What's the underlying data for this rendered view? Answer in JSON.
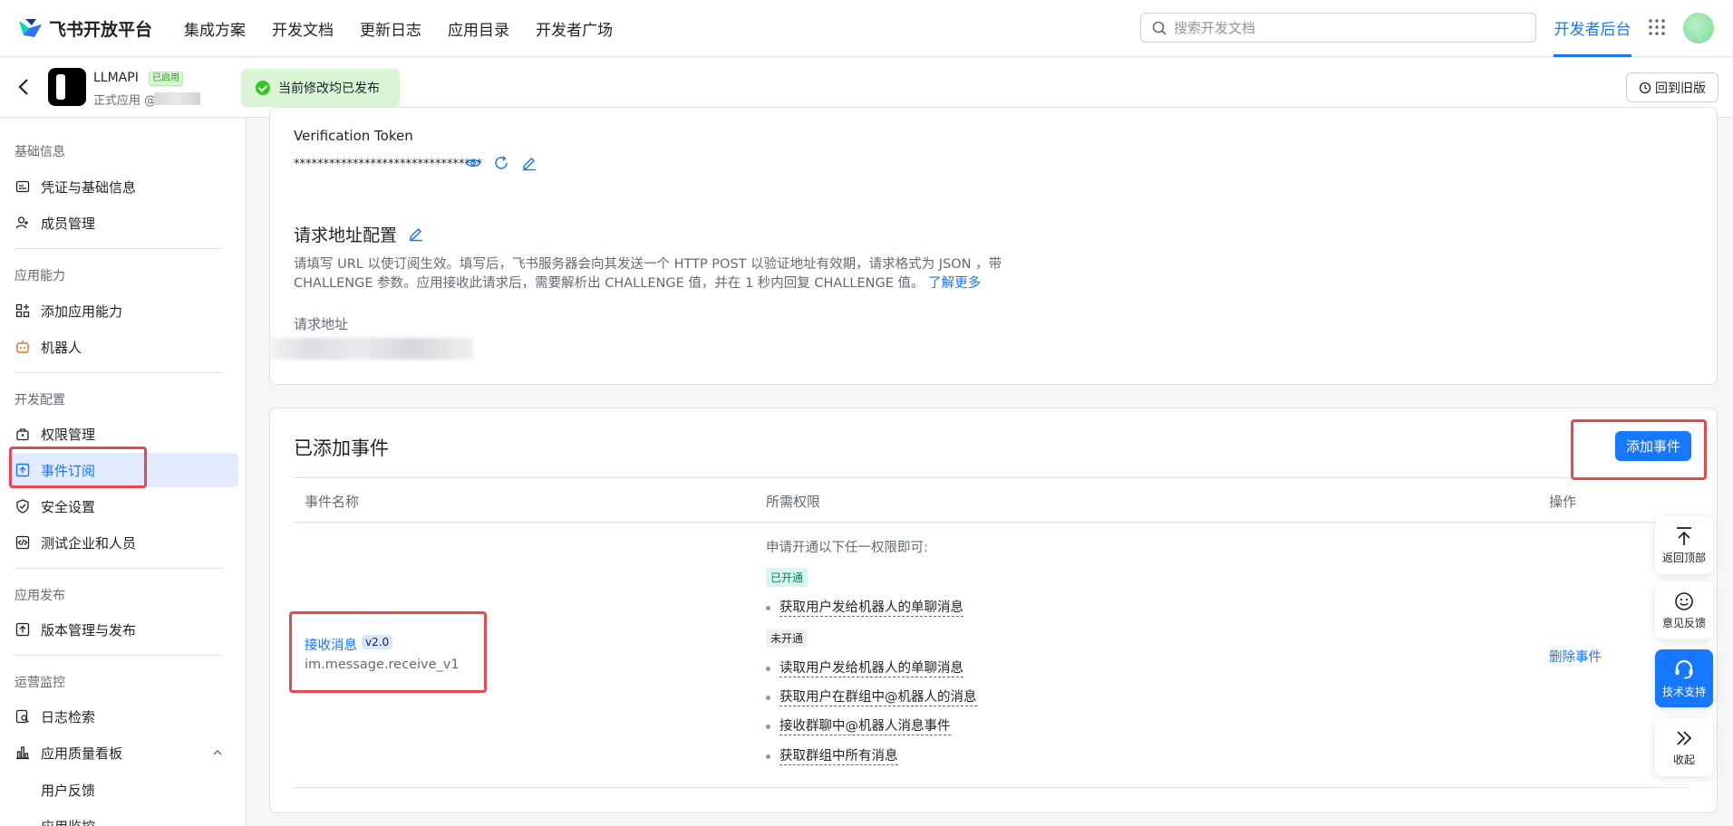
{
  "topnav": {
    "brand": "飞书开放平台",
    "links": [
      "集成方案",
      "开发文档",
      "更新日志",
      "应用目录",
      "开发者广场"
    ],
    "search_placeholder": "搜索开发文档",
    "dev_console": "开发者后台",
    "accent": "#1677ff"
  },
  "appbar": {
    "app_name": "LLMAPI",
    "app_status": "已启用",
    "app_sub": "正式应用 @",
    "publish_status": "当前修改均已发布",
    "revert_label": "回到旧版"
  },
  "sidebar": {
    "groups": {
      "basic": "基础信息",
      "capability": "应用能力",
      "dev": "开发配置",
      "release": "应用发布",
      "ops": "运营监控"
    },
    "items": {
      "credentials": "凭证与基础信息",
      "members": "成员管理",
      "add_capability": "添加应用能力",
      "bot": "机器人",
      "permissions": "权限管理",
      "events": "事件订阅",
      "security": "安全设置",
      "test_org": "测试企业和人员",
      "versions": "版本管理与发布",
      "log_search": "日志检索",
      "quality_board": "应用质量看板",
      "feedback": "用户反馈",
      "monitor": "应用监控"
    }
  },
  "verification": {
    "label": "Verification Token",
    "value": "********************************"
  },
  "request_config": {
    "title": "请求地址配置",
    "desc_line1": "请填写 URL 以使订阅生效。填写后，飞书服务器会向其发送一个 HTTP POST 以验证地址有效期，请求格式为 JSON ，带",
    "desc_line2": "CHALLENGE 参数。应用接收此请求后，需要解析出 CHALLENGE 值，并在 1 秒内回复 CHALLENGE 值。",
    "learn_more": "了解更多",
    "addr_label": "请求地址"
  },
  "events": {
    "title": "已添加事件",
    "add_button": "添加事件",
    "columns": [
      "事件名称",
      "所需权限",
      "操作"
    ],
    "rows": [
      {
        "name": "接收消息",
        "version": "v2.0",
        "code": "im.message.receive_v1",
        "perm_intro": "申请开通以下任一权限即可:",
        "enabled_tag": "已开通",
        "enabled": [
          "获取用户发给机器人的单聊消息"
        ],
        "disabled_tag": "未开通",
        "disabled": [
          "读取用户发给机器人的单聊消息",
          "获取用户在群组中@机器人的消息",
          "接收群聊中@机器人消息事件",
          "获取群组中所有消息"
        ],
        "action": "删除事件"
      }
    ]
  },
  "float_panel": {
    "top": "返回顶部",
    "feedback": "意见反馈",
    "support": "技术支持",
    "collapse": "收起"
  }
}
